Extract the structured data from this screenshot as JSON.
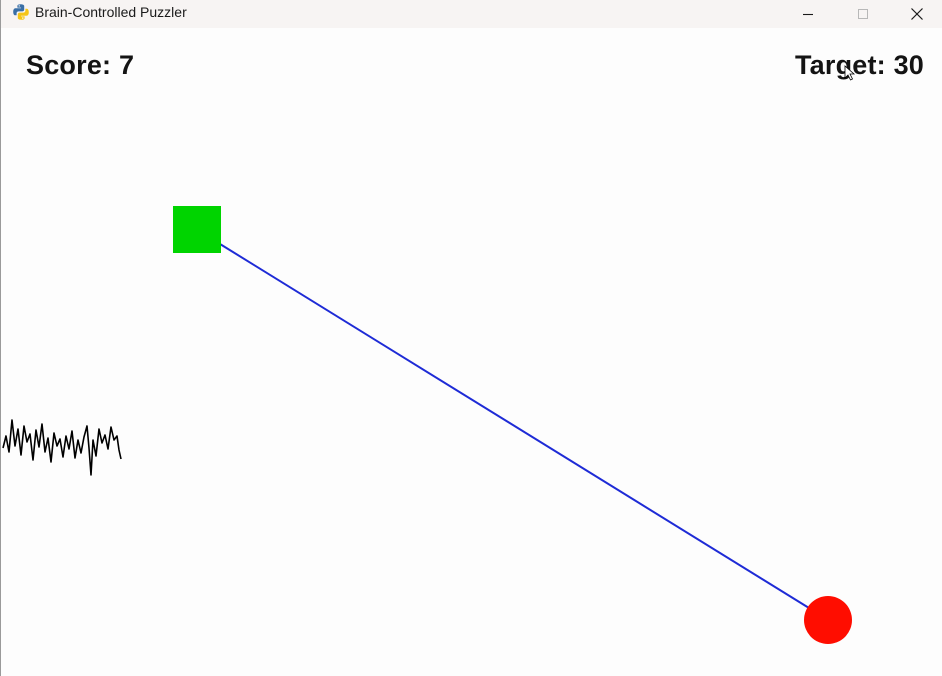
{
  "window": {
    "title": "Brain-Controlled Puzzler",
    "icon": "python-icon"
  },
  "controls": {
    "minimize_icon": "minimize-icon",
    "maximize_icon": "maximize-icon",
    "close_icon": "close-icon"
  },
  "hud": {
    "score_label": "Score:",
    "score_value": "7",
    "target_label": "Target:",
    "target_value": "30"
  },
  "scene": {
    "player": {
      "shape": "square",
      "color": "#00d400"
    },
    "goal": {
      "shape": "circle",
      "color": "#ff0d00"
    },
    "link_line": {
      "color": "#1e2bd6"
    },
    "signal_trace": {
      "color": "#000000",
      "type": "eeg-waveform"
    }
  },
  "cursor": "mouse-pointer-icon"
}
